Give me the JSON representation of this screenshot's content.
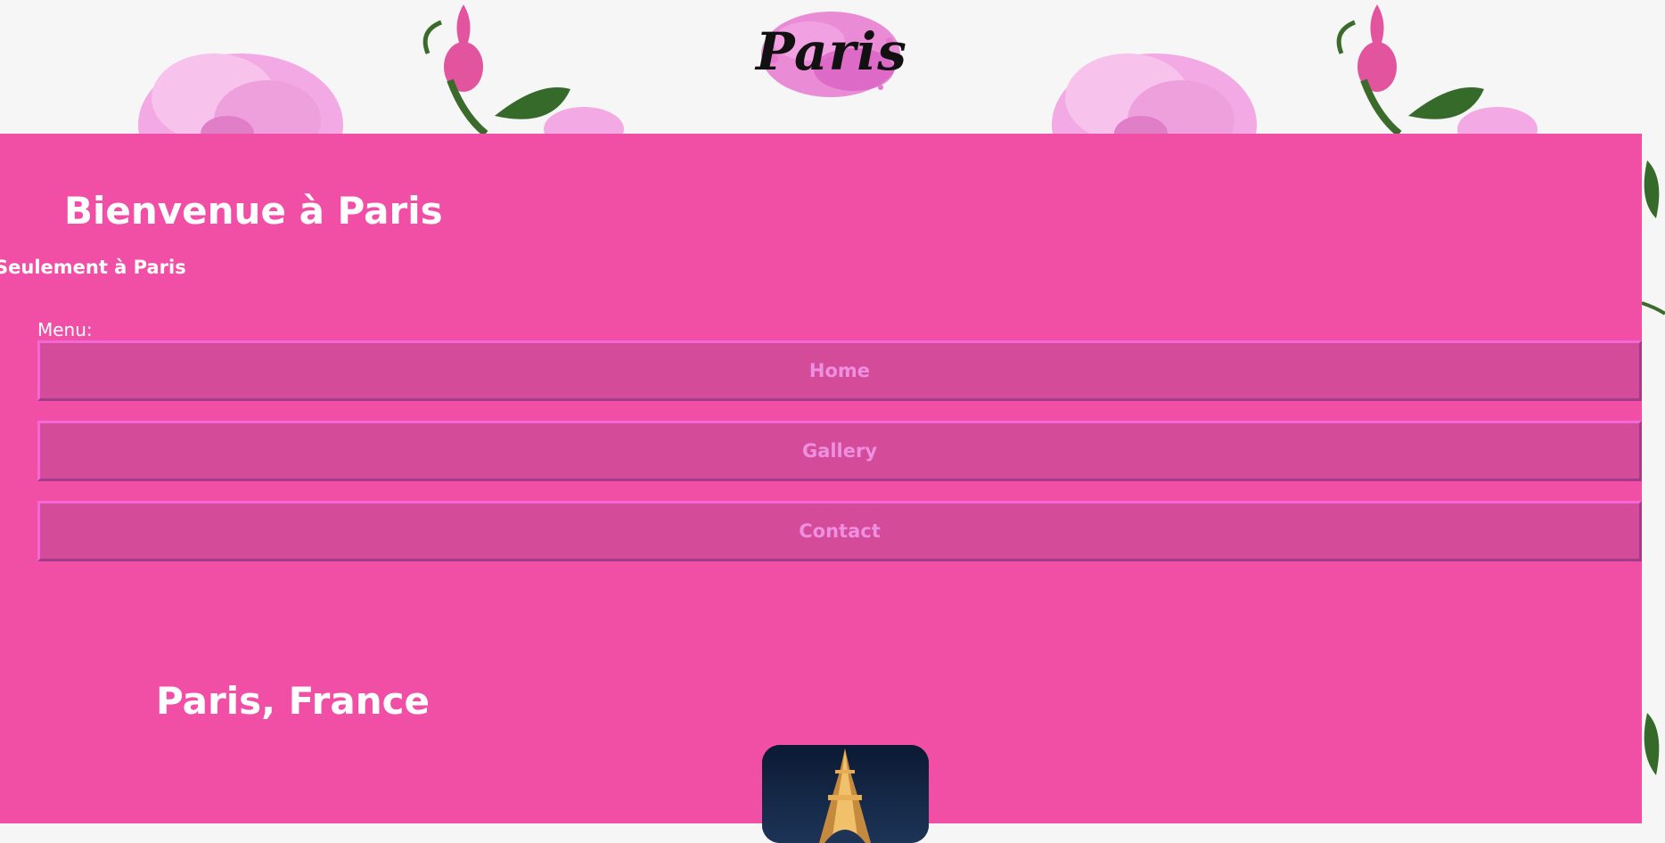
{
  "header": {
    "logo_text": "Paris"
  },
  "main": {
    "welcome_title": "Bienvenue à Paris",
    "tagline": "Seulement à Paris",
    "menu_label": "Menu:",
    "menu_items": [
      {
        "label": "Home"
      },
      {
        "label": "Gallery"
      },
      {
        "label": "Contact"
      }
    ],
    "section_title": "Paris, France"
  },
  "colors": {
    "panel_pink": "#f14fa6",
    "button_pink": "#d44b99",
    "button_text": "#ee8fe0",
    "page_background": "#f6f6f6"
  },
  "icons": {
    "logo": "paris-logo-icon",
    "background": "rose-pattern",
    "photo": "eiffel-tower-photo"
  }
}
